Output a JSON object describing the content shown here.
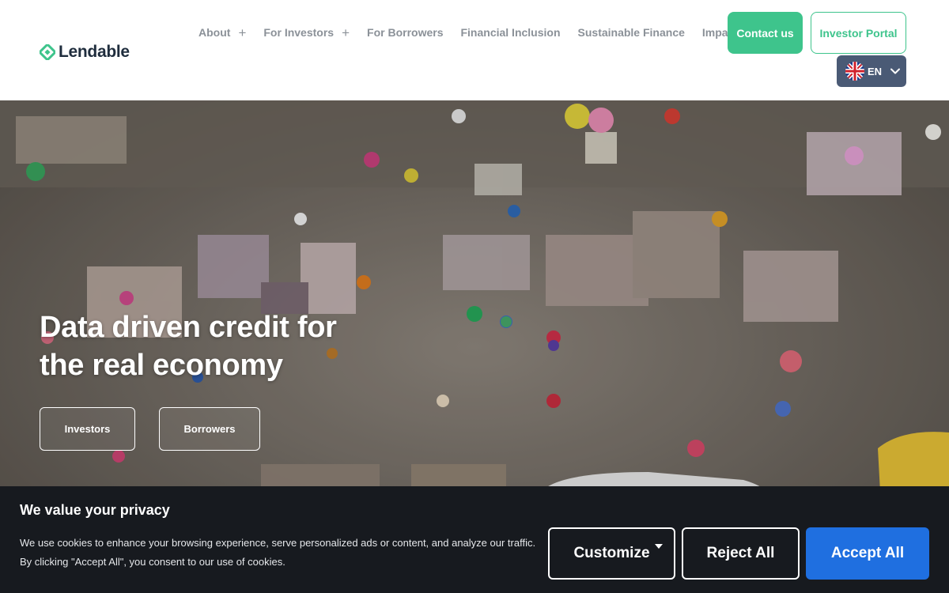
{
  "header": {
    "logo_text": "Lendable",
    "nav": [
      {
        "label": "About",
        "expandable": true
      },
      {
        "label": "For Investors",
        "expandable": true
      },
      {
        "label": "For Borrowers",
        "expandable": false
      },
      {
        "label": "Financial Inclusion",
        "expandable": false
      },
      {
        "label": "Sustainable Finance",
        "expandable": false
      },
      {
        "label": "Impact",
        "expandable": false
      }
    ],
    "plus_glyph": "+",
    "contact_label": "Contact us",
    "portal_label": "Investor Portal",
    "language": {
      "code": "EN",
      "flag_icon": "uk-flag-icon"
    }
  },
  "hero": {
    "title": "Data driven credit for the real economy",
    "investors_label": "Investors",
    "borrowers_label": "Borrowers"
  },
  "cookie_banner": {
    "title": "We value your privacy",
    "text": "We use cookies to enhance your browsing experience, serve personalized ads or content, and analyze our traffic. By clicking \"Accept All\", you consent to our use of cookies.",
    "customize_label": "Customize",
    "reject_label": "Reject All",
    "accept_label": "Accept All"
  },
  "colors": {
    "brand_green": "#3ec48c",
    "accept_blue": "#1f6fe0",
    "banner_bg": "#171a1f",
    "lang_bg": "#4a5a75"
  }
}
